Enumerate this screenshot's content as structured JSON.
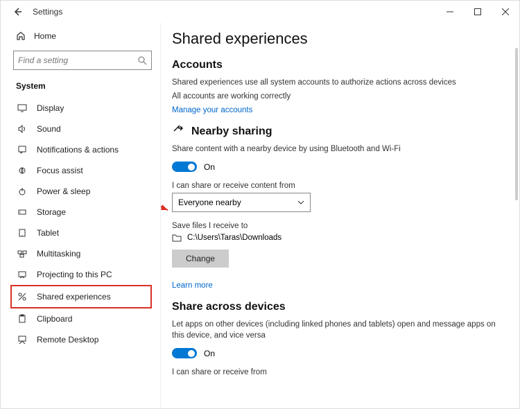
{
  "titlebar": {
    "title": "Settings"
  },
  "sidebar": {
    "home": "Home",
    "search_placeholder": "Find a setting",
    "section": "System",
    "items": [
      {
        "label": "Display"
      },
      {
        "label": "Sound"
      },
      {
        "label": "Notifications & actions"
      },
      {
        "label": "Focus assist"
      },
      {
        "label": "Power & sleep"
      },
      {
        "label": "Storage"
      },
      {
        "label": "Tablet"
      },
      {
        "label": "Multitasking"
      },
      {
        "label": "Projecting to this PC"
      },
      {
        "label": "Shared experiences"
      },
      {
        "label": "Clipboard"
      },
      {
        "label": "Remote Desktop"
      }
    ]
  },
  "main": {
    "title": "Shared experiences",
    "accounts": {
      "header": "Accounts",
      "desc": "Shared experiences use all system accounts to authorize actions across devices",
      "status": "All accounts are working correctly",
      "manage_link": "Manage your accounts"
    },
    "nearby": {
      "header": "Nearby sharing",
      "desc": "Share content with a nearby device by using Bluetooth and Wi-Fi",
      "toggle_label": "On",
      "share_from_label": "I can share or receive content from",
      "share_from_value": "Everyone nearby",
      "save_label": "Save files I receive to",
      "save_path": "C:\\Users\\Taras\\Downloads",
      "change_btn": "Change",
      "learn_more": "Learn more"
    },
    "across": {
      "header": "Share across devices",
      "desc": "Let apps on other devices (including linked phones and tablets) open and message apps on this device, and vice versa",
      "toggle_label": "On",
      "from_label": "I can share or receive from"
    }
  }
}
